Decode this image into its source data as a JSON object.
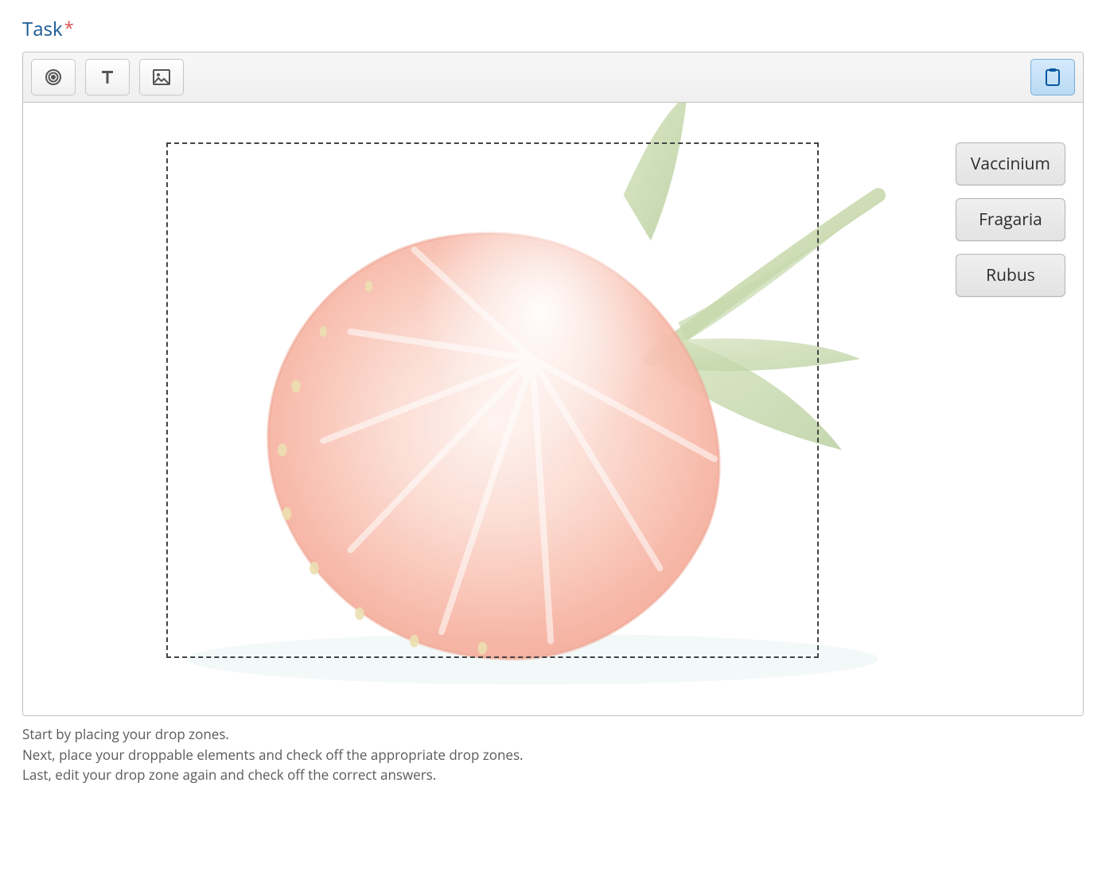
{
  "label": "Task",
  "required_marker": "*",
  "toolbar": {
    "target_tool": "target-icon",
    "text_tool": "text-icon",
    "image_tool": "image-icon",
    "paste_tool": "clipboard-icon"
  },
  "draggables": [
    "Vaccinium",
    "Fragaria",
    "Rubus"
  ],
  "instructions": [
    "Start by placing your drop zones.",
    "Next, place your droppable elements and check off the appropriate drop zones.",
    "Last, edit your drop zone again and check off the correct answers."
  ]
}
